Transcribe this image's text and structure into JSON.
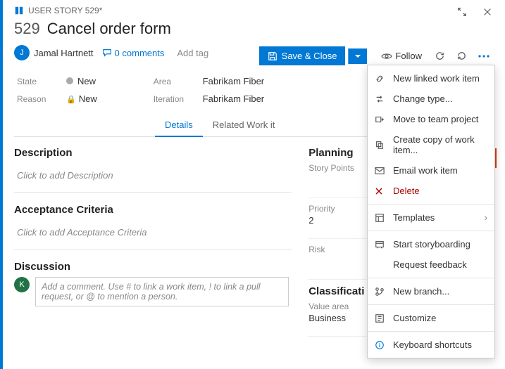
{
  "breadcrumb": {
    "label": "USER STORY 529*"
  },
  "title": {
    "id": "529",
    "text": "Cancel order form"
  },
  "assignee": {
    "name": "Jamal Hartnett",
    "initial": "J"
  },
  "comments": {
    "count_label": "0 comments"
  },
  "add_tag_label": "Add tag",
  "save": {
    "label": "Save & Close"
  },
  "follow_label": "Follow",
  "fields": {
    "state_label": "State",
    "state_value": "New",
    "reason_label": "Reason",
    "reason_value": "New",
    "area_label": "Area",
    "area_value": "Fabrikam Fiber",
    "iteration_label": "Iteration",
    "iteration_value": "Fabrikam Fiber"
  },
  "tabs": {
    "details": "Details",
    "related": "Related Work it"
  },
  "left": {
    "description_h": "Description",
    "description_ph": "Click to add Description",
    "acceptance_h": "Acceptance Criteria",
    "acceptance_ph": "Click to add Acceptance Criteria",
    "discussion_h": "Discussion",
    "discussion_initial": "K",
    "comment_ph": "Add a comment. Use # to link a work item, ! to link a pull request, or @ to mention a person."
  },
  "right": {
    "planning_h": "Planning",
    "story_points_l": "Story Points",
    "story_points_v": "",
    "priority_l": "Priority",
    "priority_v": "2",
    "risk_l": "Risk",
    "risk_v": "",
    "classification_h": "Classificati",
    "value_area_l": "Value area",
    "value_area_v": "Business"
  },
  "menu": {
    "new_linked": "New linked work item",
    "change_type": "Change type...",
    "move_team": "Move to team project",
    "create_copy": "Create copy of work item...",
    "email": "Email work item",
    "delete": "Delete",
    "templates": "Templates",
    "storyboard": "Start storyboarding",
    "feedback": "Request feedback",
    "new_branch": "New branch...",
    "customize": "Customize",
    "shortcuts": "Keyboard shortcuts"
  }
}
